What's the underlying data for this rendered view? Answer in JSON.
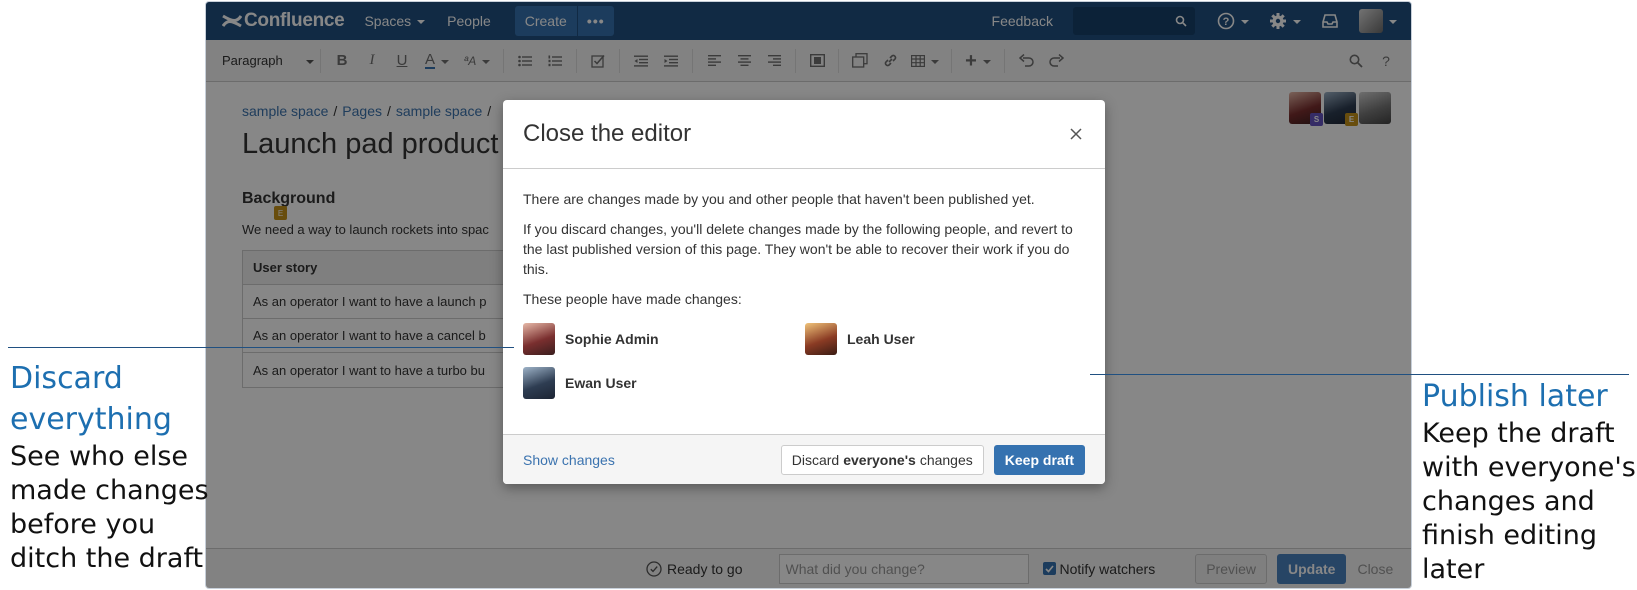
{
  "topbar": {
    "brand": "Confluence",
    "nav": {
      "spaces": "Spaces",
      "people": "People",
      "create": "Create"
    },
    "feedback": "Feedback",
    "colors": {
      "bg": "#205081",
      "create": "#3572b0"
    }
  },
  "toolbar": {
    "paragraph": "Paragraph"
  },
  "page": {
    "breadcrumb": [
      "sample space",
      "Pages",
      "sample space"
    ],
    "title": "Launch pad product r",
    "heading": "Background",
    "text": "We need a way to launch rockets into spac",
    "marker": "E",
    "table": {
      "header": "User story",
      "rows": [
        "As an operator I want to have a launch p",
        "As an operator I want to have a cancel b",
        "As an operator I want to have a turbo bu"
      ]
    },
    "collaborators": [
      {
        "badge": "S",
        "badge_color": "#6554c0"
      },
      {
        "badge": "E",
        "badge_color": "#c4921a"
      },
      {
        "badge": "",
        "badge_color": ""
      }
    ]
  },
  "statusbar": {
    "ready": "Ready to go",
    "change_placeholder": "What did you change?",
    "notify": "Notify watchers",
    "preview": "Preview",
    "update": "Update",
    "close": "Close"
  },
  "dialog": {
    "title": "Close the editor",
    "p1": "There are changes made by you and other people that haven't been published yet.",
    "p2": "If you discard changes, you'll delete changes made by the following people, and revert to the last published version of this page. They won't be able to recover their work if you do this.",
    "p3": "These people have made changes:",
    "people": [
      {
        "name": "Sophie Admin"
      },
      {
        "name": "Leah User"
      },
      {
        "name": "Ewan User"
      }
    ],
    "show_changes": "Show changes",
    "discard": {
      "pre": "Discard",
      "bold": "everyone's",
      "post": "changes"
    },
    "keep_draft": "Keep draft"
  },
  "annotations": {
    "left": {
      "head": [
        "Discard",
        "everything"
      ],
      "sub": [
        "See who else",
        "made changes",
        "before you",
        "ditch the draft"
      ]
    },
    "right": {
      "head": [
        "Publish later"
      ],
      "sub": [
        "Keep the draft",
        "with everyone's",
        "changes and",
        "finish editing",
        "later"
      ]
    }
  }
}
